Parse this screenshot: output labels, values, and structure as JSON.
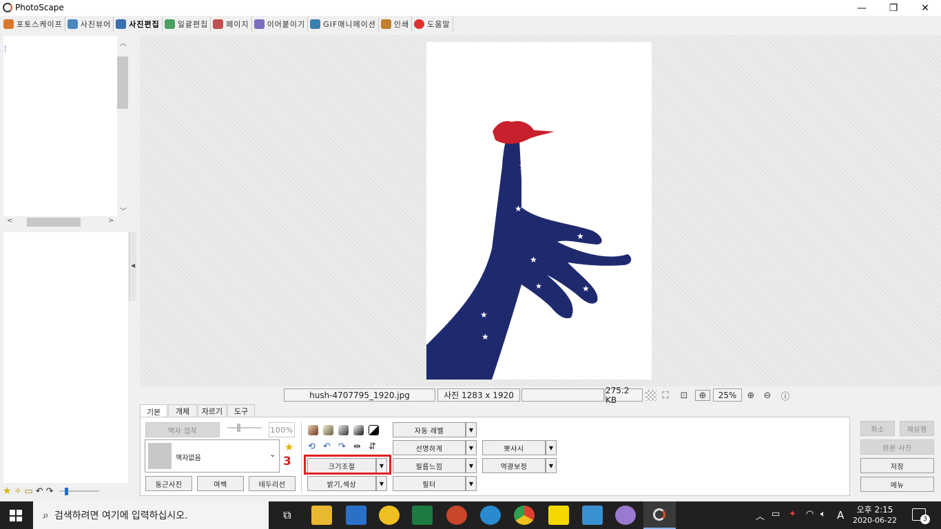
{
  "app": {
    "title": "PhotoScape"
  },
  "window_controls": {
    "minimize": "—",
    "restore": "❐",
    "close": "✕"
  },
  "menu_tabs": [
    {
      "label": "포토스케이프",
      "color": "#d9782c"
    },
    {
      "label": "사진뷰어",
      "color": "#4a88c0"
    },
    {
      "label": "사진편집",
      "color": "#3a6fb0",
      "active": true
    },
    {
      "label": "일괄편집",
      "color": "#4aa060"
    },
    {
      "label": "페이지",
      "color": "#c05050"
    },
    {
      "label": "이어붙이기",
      "color": "#7a70c0"
    },
    {
      "label": "GIF애니메이션",
      "color": "#3a80b0"
    },
    {
      "label": "인쇄",
      "color": "#c08030"
    },
    {
      "label": "도움말",
      "color": "#e03030"
    }
  ],
  "status": {
    "filename": "hush-4707795_1920.jpg",
    "dimensions": "사진 1283 x 1920",
    "filesize": "275.2 KB",
    "zoom": "25%"
  },
  "panel_tabs": [
    "기본",
    "개체",
    "자르기",
    "도구"
  ],
  "frame": {
    "apply_button": "액자 접착",
    "percent": "100%",
    "selected": "액자없음"
  },
  "frame_buttons": {
    "round": "둥근사진",
    "margin": "여백",
    "border": "테두리선"
  },
  "step_number": "3",
  "edit_buttons": {
    "resize": "크기조절",
    "brightness": "밝기,색상",
    "auto_level": "자동 레벨",
    "sharpen": "선명하게",
    "film": "필름느낌",
    "filter": "필터",
    "bokeh": "뽀샤시",
    "backlight": "역광보정"
  },
  "right_buttons": {
    "undo": "취소",
    "redo": "재실행",
    "original": "원본 사진",
    "save": "저장",
    "menu": "메뉴"
  },
  "taskbar": {
    "search_placeholder": "검색하려면 여기에 입력하십시오.",
    "time": "오후 2:15",
    "date": "2020-06-22",
    "ime": "A",
    "notifications": "3"
  }
}
